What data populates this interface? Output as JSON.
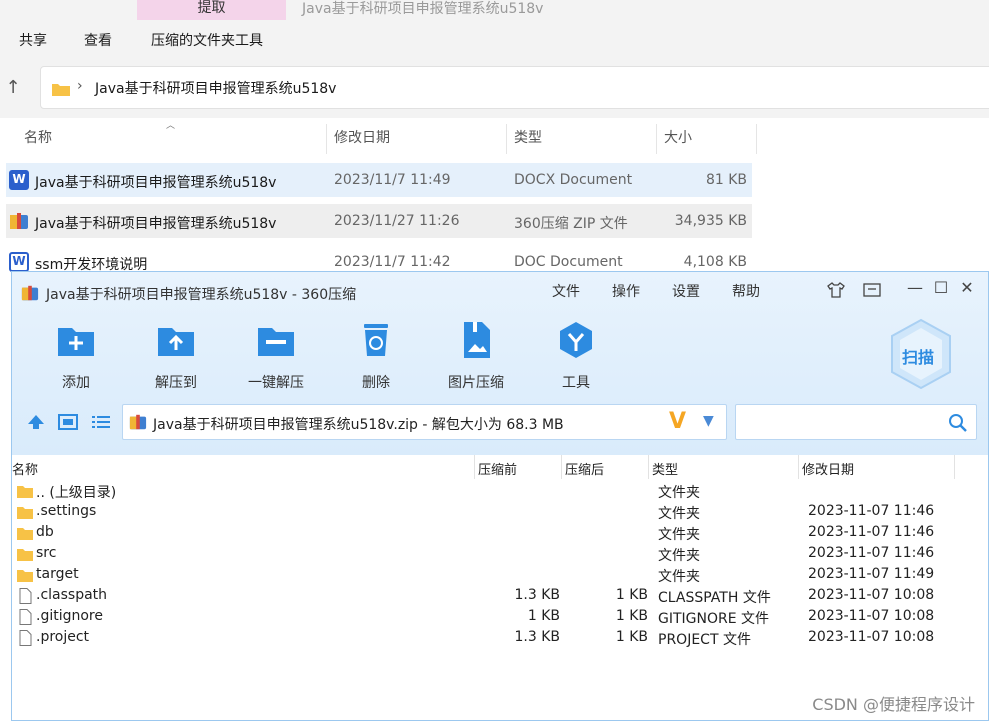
{
  "explorer": {
    "extract_tab": "提取",
    "window_title": "Java基于科研项目申报管理系统u518v",
    "ribbon": [
      "共享",
      "查看",
      "压缩的文件夹工具"
    ],
    "address_path": "Java基于科研项目申报管理系统u518v",
    "columns": {
      "name": "名称",
      "date": "修改日期",
      "type": "类型",
      "size": "大小"
    },
    "files": [
      {
        "name": "Java基于科研项目申报管理系统u518v",
        "date": "2023/11/7 11:49",
        "type": "DOCX Document",
        "size": "81 KB",
        "icon": "word-icon"
      },
      {
        "name": "Java基于科研项目申报管理系统u518v",
        "date": "2023/11/27 11:26",
        "type": "360压缩 ZIP 文件",
        "size": "34,935 KB",
        "icon": "zip-archive-icon"
      },
      {
        "name": "ssm开发环境说明",
        "date": "2023/11/7 11:42",
        "type": "DOC Document",
        "size": "4,108 KB",
        "icon": "word-doc-icon"
      }
    ]
  },
  "zip": {
    "title": "Java基于科研项目申报管理系统u518v - 360压缩",
    "menu": [
      "文件",
      "操作",
      "设置",
      "帮助"
    ],
    "toolbar": [
      {
        "label": "添加",
        "icon": "add-icon"
      },
      {
        "label": "解压到",
        "icon": "extract-to-icon"
      },
      {
        "label": "一键解压",
        "icon": "one-click-extract-icon"
      },
      {
        "label": "删除",
        "icon": "delete-icon"
      },
      {
        "label": "图片压缩",
        "icon": "image-compress-icon"
      },
      {
        "label": "工具",
        "icon": "tools-icon"
      }
    ],
    "scan_label": "扫描",
    "path_text": "Java基于科研项目申报管理系统u518v.zip - 解包大小为 68.3 MB",
    "columns": {
      "name": "名称",
      "compressed": "压缩前",
      "packed": "压缩后",
      "type": "类型",
      "date": "修改日期"
    },
    "entries": [
      {
        "name": ".. (上级目录)",
        "orig": "",
        "packed": "",
        "type": "文件夹",
        "date": "",
        "kind": "folder"
      },
      {
        "name": ".settings",
        "orig": "",
        "packed": "",
        "type": "文件夹",
        "date": "2023-11-07 11:46",
        "kind": "folder"
      },
      {
        "name": "db",
        "orig": "",
        "packed": "",
        "type": "文件夹",
        "date": "2023-11-07 11:46",
        "kind": "folder"
      },
      {
        "name": "src",
        "orig": "",
        "packed": "",
        "type": "文件夹",
        "date": "2023-11-07 11:46",
        "kind": "folder"
      },
      {
        "name": "target",
        "orig": "",
        "packed": "",
        "type": "文件夹",
        "date": "2023-11-07 11:49",
        "kind": "folder"
      },
      {
        "name": ".classpath",
        "orig": "1.3 KB",
        "packed": "1 KB",
        "type": "CLASSPATH 文件",
        "date": "2023-11-07 10:08",
        "kind": "file"
      },
      {
        "name": ".gitignore",
        "orig": "1 KB",
        "packed": "1 KB",
        "type": "GITIGNORE 文件",
        "date": "2023-11-07 10:08",
        "kind": "file"
      },
      {
        "name": ".project",
        "orig": "1.3 KB",
        "packed": "1 KB",
        "type": "PROJECT 文件",
        "date": "2023-11-07 10:08",
        "kind": "file"
      }
    ]
  },
  "watermark": "CSDN @便捷程序设计",
  "colors": {
    "accent": "#2d8be0",
    "folder": "#f7c246",
    "selection": "#e6f0fb"
  }
}
